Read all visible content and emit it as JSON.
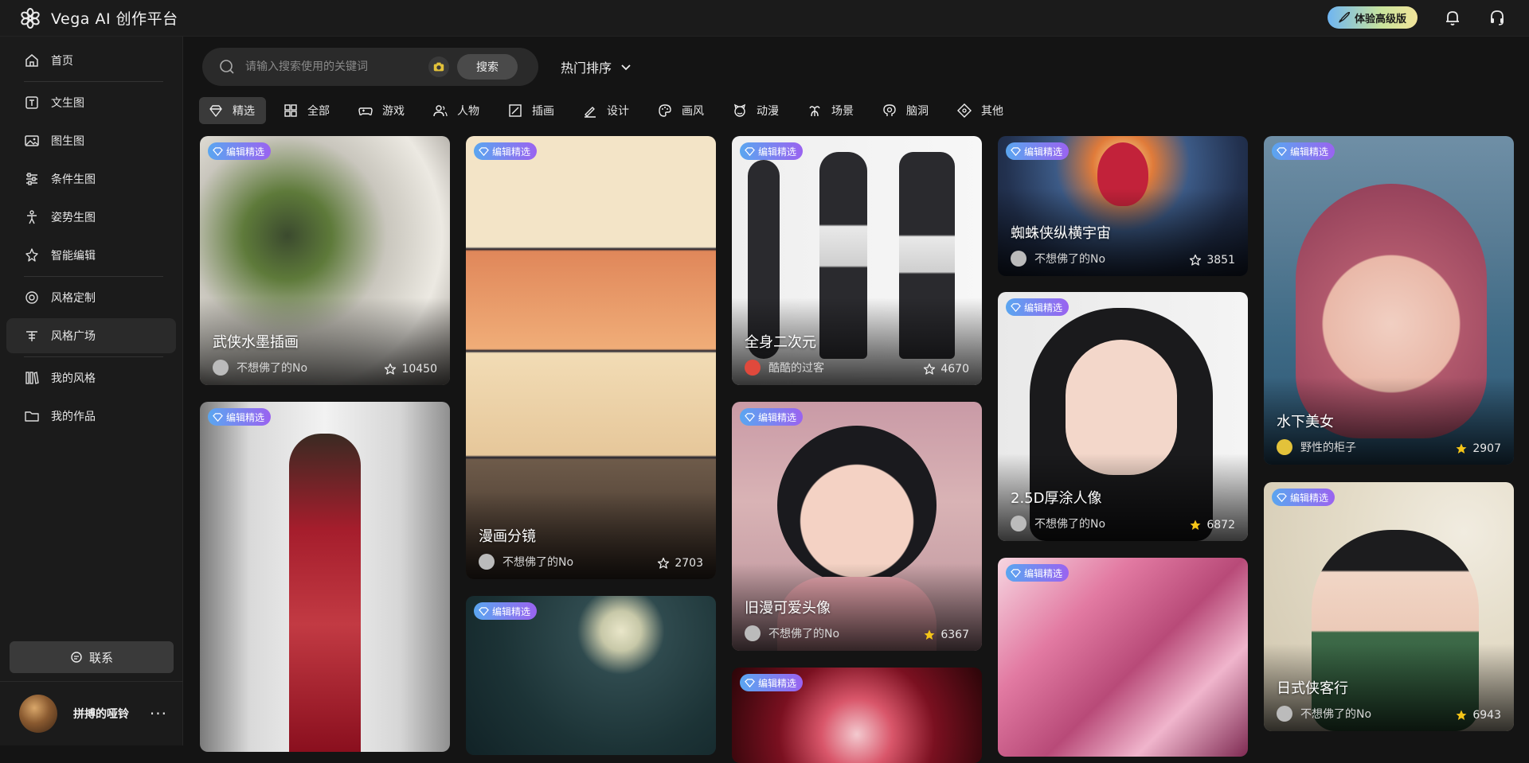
{
  "app": {
    "title": "Vega AI 创作平台",
    "premium_label": "体验高级版"
  },
  "sidebar": {
    "items": [
      {
        "label": "首页",
        "icon": "home-icon"
      },
      {
        "label": "文生图",
        "icon": "text-to-image-icon"
      },
      {
        "label": "图生图",
        "icon": "image-to-image-icon"
      },
      {
        "label": "条件生图",
        "icon": "sliders-icon"
      },
      {
        "label": "姿势生图",
        "icon": "pose-icon"
      },
      {
        "label": "智能编辑",
        "icon": "magic-edit-icon"
      },
      {
        "label": "风格定制",
        "icon": "style-custom-icon"
      },
      {
        "label": "风格广场",
        "icon": "style-square-icon",
        "active": true
      },
      {
        "label": "我的风格",
        "icon": "my-style-icon"
      },
      {
        "label": "我的作品",
        "icon": "folder-icon"
      }
    ],
    "contact_label": "联系",
    "user_name": "拼搏的哑铃",
    "more_label": "···"
  },
  "search": {
    "placeholder": "请输入搜索使用的关键词",
    "button_label": "搜索"
  },
  "sort": {
    "selected": "热门排序"
  },
  "tabs": [
    {
      "label": "精选",
      "icon": "diamond-icon",
      "active": true
    },
    {
      "label": "全部",
      "icon": "grid-icon"
    },
    {
      "label": "游戏",
      "icon": "gamepad-icon"
    },
    {
      "label": "人物",
      "icon": "person-icon"
    },
    {
      "label": "插画",
      "icon": "illustration-icon"
    },
    {
      "label": "设计",
      "icon": "pen-icon"
    },
    {
      "label": "画风",
      "icon": "palette-icon"
    },
    {
      "label": "动漫",
      "icon": "anime-face-icon"
    },
    {
      "label": "场景",
      "icon": "scene-icon"
    },
    {
      "label": "脑洞",
      "icon": "brain-icon"
    },
    {
      "label": "其他",
      "icon": "other-icon"
    }
  ],
  "badge_label": "编辑精选",
  "cards": [
    {
      "title": "武侠水墨插画",
      "author": "不想佛了的No",
      "likes": "10450"
    },
    {
      "title": "",
      "author": "",
      "likes": ""
    },
    {
      "title": "漫画分镜",
      "author": "不想佛了的No",
      "likes": "2703"
    },
    {
      "title": "",
      "author": "",
      "likes": ""
    },
    {
      "title": "全身二次元",
      "author": "酷酷的过客",
      "likes": "4670"
    },
    {
      "title": "旧漫可爱头像",
      "author": "不想佛了的No",
      "likes": "6367"
    },
    {
      "title": "",
      "author": "",
      "likes": ""
    },
    {
      "title": "蜘蛛侠纵横宇宙",
      "author": "不想佛了的No",
      "likes": "3851"
    },
    {
      "title": "2.5D厚涂人像",
      "author": "不想佛了的No",
      "likes": "6872"
    },
    {
      "title": "",
      "author": "",
      "likes": ""
    },
    {
      "title": "水下美女",
      "author": "野性的柜子",
      "likes": "2907"
    },
    {
      "title": "日式侠客行",
      "author": "不想佛了的No",
      "likes": "6943"
    }
  ]
}
